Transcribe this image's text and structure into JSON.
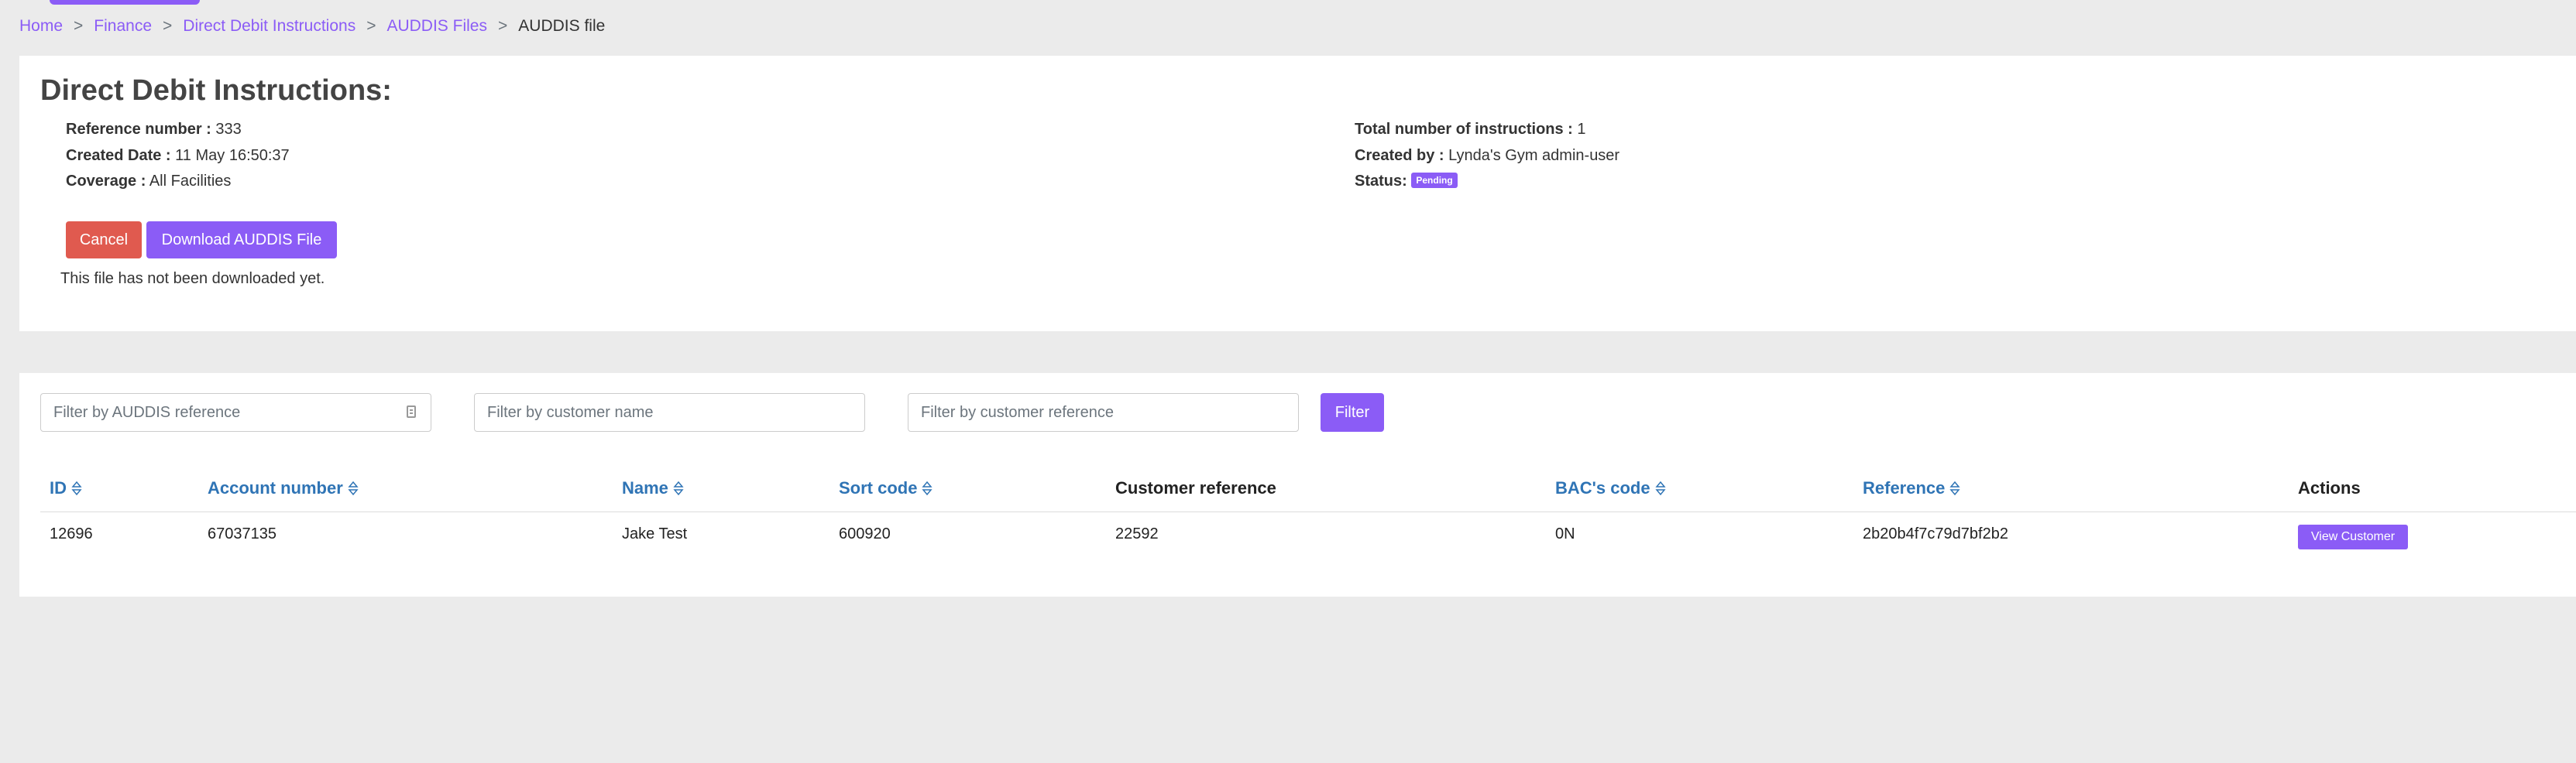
{
  "breadcrumb": {
    "items": [
      "Home",
      "Finance",
      "Direct Debit Instructions",
      "AUDDIS Files"
    ],
    "separator": ">",
    "current": "AUDDIS file"
  },
  "details": {
    "title": "Direct Debit Instructions:",
    "reference_label": "Reference number :",
    "reference_value": "333",
    "created_date_label": "Created Date :",
    "created_date_value": "11 May 16:50:37",
    "coverage_label": "Coverage :",
    "coverage_value": "All Facilities",
    "total_label": "Total number of instructions :",
    "total_value": "1",
    "created_by_label": "Created by :",
    "created_by_value": "Lynda's Gym admin-user",
    "status_label": "Status:",
    "status_value": "Pending",
    "cancel_label": "Cancel",
    "download_label": "Download AUDDIS File",
    "download_note": "This file has not been downloaded yet."
  },
  "filters": {
    "auddis_placeholder": "Filter by AUDDIS reference",
    "customer_name_placeholder": "Filter by customer name",
    "customer_ref_placeholder": "Filter by customer reference",
    "filter_button": "Filter",
    "input_icon": "clipboard-icon"
  },
  "table": {
    "columns": [
      {
        "label": "ID",
        "sortable": true
      },
      {
        "label": "Account number",
        "sortable": true
      },
      {
        "label": "Name",
        "sortable": true
      },
      {
        "label": "Sort code",
        "sortable": true
      },
      {
        "label": "Customer reference",
        "sortable": false
      },
      {
        "label": "BAC's code",
        "sortable": true
      },
      {
        "label": "Reference",
        "sortable": true
      },
      {
        "label": "Actions",
        "sortable": false
      }
    ],
    "rows": [
      {
        "id": "12696",
        "account": "67037135",
        "name": "Jake Test",
        "sort_code": "600920",
        "customer_ref": "22592",
        "bacs": "0N",
        "reference": "2b20b4f7c79d7bf2b2",
        "action_label": "View Customer"
      }
    ]
  },
  "colors": {
    "accent": "#8b5cf6",
    "danger": "#e05a4f",
    "link": "#2f74b5",
    "background": "#ebebeb"
  }
}
